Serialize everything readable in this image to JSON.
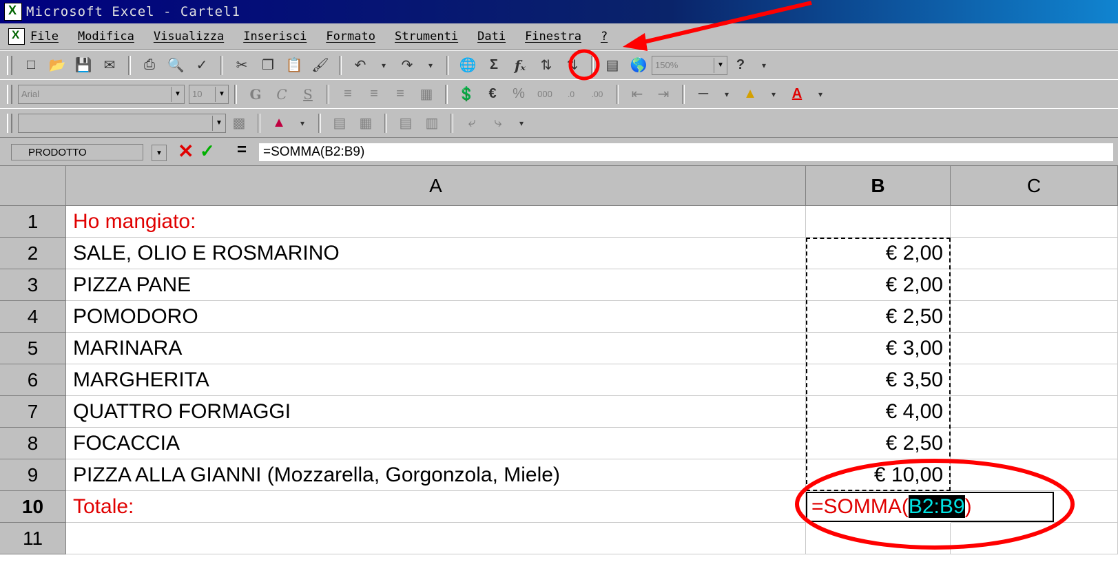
{
  "window": {
    "title": "Microsoft Excel - Cartel1"
  },
  "menu": {
    "items": [
      "File",
      "Modifica",
      "Visualizza",
      "Inserisci",
      "Formato",
      "Strumenti",
      "Dati",
      "Finestra",
      "?"
    ]
  },
  "toolbar": {
    "zoom": "150%",
    "font": "Arial",
    "font_size": "10"
  },
  "formula_bar": {
    "name_box": "PRODOTTO",
    "equals": "=",
    "formula": "=SOMMA(B2:B9)"
  },
  "sheet": {
    "columns": [
      "A",
      "B",
      "C"
    ],
    "rows": [
      {
        "n": "1",
        "a": "Ho mangiato:",
        "b": ""
      },
      {
        "n": "2",
        "a": "SALE, OLIO E ROSMARINO",
        "b": "€ 2,00"
      },
      {
        "n": "3",
        "a": "PIZZA PANE",
        "b": "€ 2,00"
      },
      {
        "n": "4",
        "a": "POMODORO",
        "b": "€ 2,50"
      },
      {
        "n": "5",
        "a": "MARINARA",
        "b": "€ 3,00"
      },
      {
        "n": "6",
        "a": "MARGHERITA",
        "b": "€ 3,50"
      },
      {
        "n": "7",
        "a": "QUATTRO FORMAGGI",
        "b": "€ 4,00"
      },
      {
        "n": "8",
        "a": "FOCACCIA",
        "b": "€ 2,50"
      },
      {
        "n": "9",
        "a": "PIZZA ALLA GIANNI (Mozzarella, Gorgonzola, Miele)",
        "b": "€ 10,00"
      },
      {
        "n": "10",
        "a": "Totale:",
        "b": ""
      },
      {
        "n": "11",
        "a": "",
        "b": ""
      }
    ],
    "edit": {
      "prefix": "=SOMMA(",
      "range": "B2:B9",
      "suffix": ")"
    }
  },
  "colors": {
    "title_bar": "#000080",
    "accent_red": "#e00000",
    "annotation_red": "#ff0000"
  }
}
